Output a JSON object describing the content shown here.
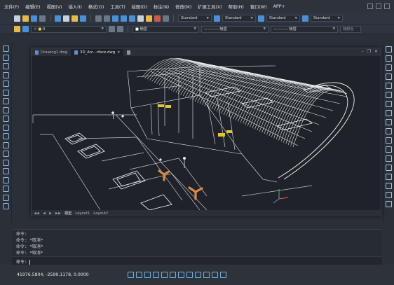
{
  "menu": [
    "文件(F)",
    "编辑(E)",
    "视图(V)",
    "插入(I)",
    "格式(O)",
    "工具(T)",
    "绘图(D)",
    "标注(N)",
    "修改(M)",
    "扩展工具(X)",
    "帮助(H)",
    "窗口(W)",
    "APP+"
  ],
  "toolbar": {
    "style_1": "Standard",
    "style_2": "Standard",
    "style_3": "Standard",
    "style_4": "Standard",
    "layer_value": "0",
    "color_value": "随层",
    "linetype_value": "随层",
    "lineweight_value": "随层",
    "plotstyle_value": "随颜色"
  },
  "tabs": [
    {
      "label": "Drawing1.dwg",
      "active": false
    },
    {
      "label": "3D_Arc...rface.dwg",
      "active": true
    }
  ],
  "layout_tabs": [
    "模型",
    "Layout1",
    "Layout2"
  ],
  "command_history": [
    "命令:",
    "命令: *取消*",
    "命令: *取消*",
    "命令: *取消*"
  ],
  "command_prompt": "命令:",
  "coordinates": "41976.5804, -2599.1178, 0.0000",
  "colors": {
    "accent": "#4b8fd6",
    "drawing_white": "#e8ecf2",
    "ground_line": "#bfc6cf",
    "fixture_orange": "#d98a4a",
    "vehicle_yellow": "#e0c62f"
  }
}
